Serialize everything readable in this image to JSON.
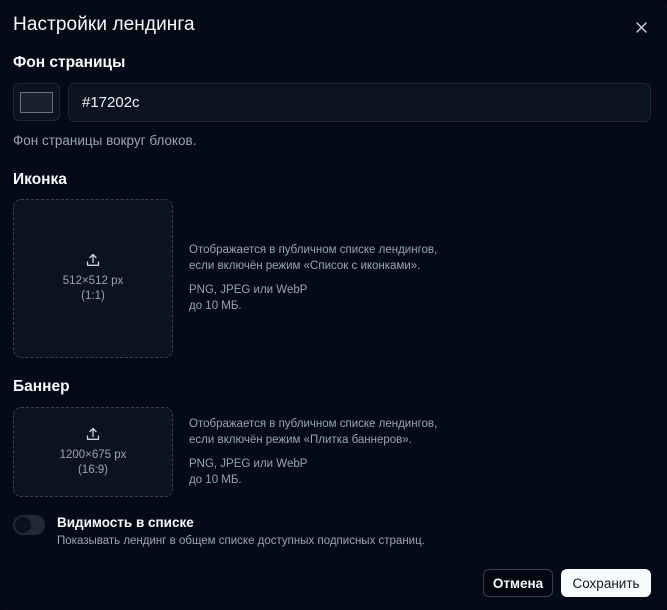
{
  "dialog": {
    "title": "Настройки лендинга",
    "close_icon": "close-icon"
  },
  "background": {
    "label": "Фон страницы",
    "color_value": "#17202c",
    "hint": "Фон страницы вокруг блоков."
  },
  "icon": {
    "label": "Иконка",
    "upload_icon": "upload-icon",
    "size": "512×512 px",
    "ratio": "(1:1)",
    "desc_line1": "Отображается в публичном списке лендингов,",
    "desc_line2": "если включён режим «Список с иконками».",
    "formats": "PNG, JPEG или WebP",
    "max_size": "до 10 МБ."
  },
  "banner": {
    "label": "Баннер",
    "upload_icon": "upload-icon",
    "size": "1200×675 px",
    "ratio": "(16:9)",
    "desc_line1": "Отображается в публичном списке лендингов,",
    "desc_line2": "если включён режим «Плитка баннеров».",
    "formats": "PNG, JPEG или WebP",
    "max_size": "до 10 МБ."
  },
  "visibility": {
    "title": "Видимость в списке",
    "hint": "Показывать лендинг в общем списке доступных подписных страниц.",
    "enabled": false
  },
  "footer": {
    "cancel_label": "Отмена",
    "save_label": "Сохранить"
  },
  "colors": {
    "background": "#050a18",
    "field": "#0b1220",
    "border": "#1f2937",
    "muted_text": "#9ca3af",
    "swatch": "#17202c"
  }
}
